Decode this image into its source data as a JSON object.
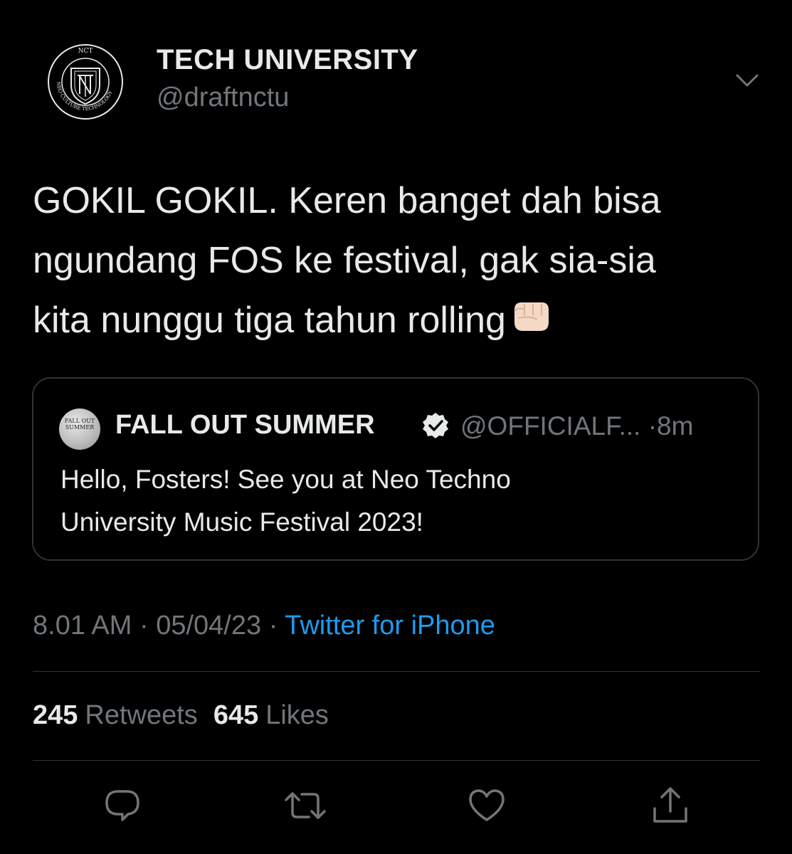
{
  "author": {
    "display_name": "TECH UNIVERSITY",
    "handle": "@draftnctu",
    "avatar_icon": "nct-emblem-avatar",
    "avatar_text": {
      "top": "NCT",
      "ring": "NEO CULTURE TECHNOLOGY"
    }
  },
  "tweet": {
    "text_lines": [
      "GOKIL GOKIL. Keren banget dah bisa",
      "ngundang FOS ke festival, gak sia-sia",
      "kita nunggu tiga tahun rolling"
    ],
    "emoji": "fist-emoji"
  },
  "quote": {
    "avatar_text": [
      "FALL OUT",
      "SUMMER"
    ],
    "name": "FALL OUT SUMMER",
    "verified": true,
    "handle": "@OFFICIALF...",
    "separator": "·",
    "time": "8m",
    "text_lines": [
      "Hello, Fosters! See you at Neo Techno",
      "University Music Festival 2023!"
    ]
  },
  "meta": {
    "time": "8.01 AM",
    "separator": "·",
    "date": "05/04/23",
    "source": "Twitter for iPhone"
  },
  "stats": {
    "retweets_count": "245",
    "retweets_label": "Retweets",
    "likes_count": "645",
    "likes_label": "Likes"
  },
  "colors": {
    "background": "#000000",
    "text": "#e7e9ea",
    "muted": "#71767b",
    "link": "#1d9bf0",
    "border": "#2f3336"
  },
  "actions": [
    "reply-icon",
    "retweet-icon",
    "like-icon",
    "share-icon"
  ]
}
